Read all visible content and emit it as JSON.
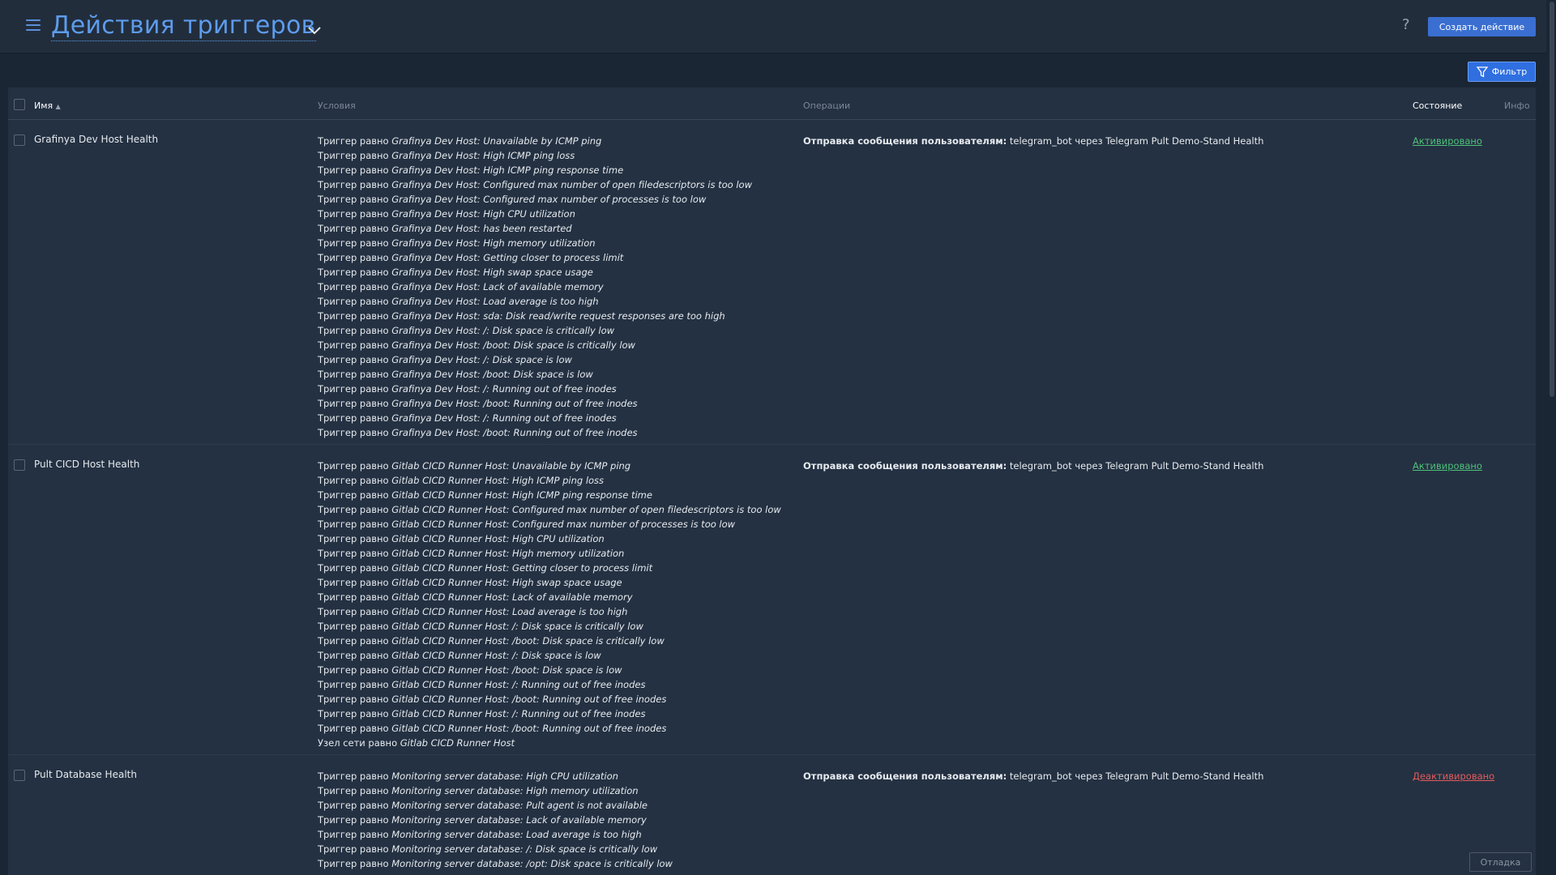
{
  "header": {
    "title": "Действия триггеров",
    "help_label": "?",
    "create_label": "Создать действие"
  },
  "filter": {
    "label": "Фильтр"
  },
  "columns": {
    "name": "Имя",
    "sort_indicator": "▲",
    "conditions": "Условия",
    "operations": "Операции",
    "status": "Состояние",
    "info": "Инфо"
  },
  "rows": [
    {
      "name": "Grafinya Dev Host Health",
      "conditions": [
        {
          "prefix": "Триггер равно",
          "value": "Grafinya Dev Host: Unavailable by ICMP ping"
        },
        {
          "prefix": "Триггер равно",
          "value": "Grafinya Dev Host: High ICMP ping loss"
        },
        {
          "prefix": "Триггер равно",
          "value": "Grafinya Dev Host: High ICMP ping response time"
        },
        {
          "prefix": "Триггер равно",
          "value": "Grafinya Dev Host: Configured max number of open filedescriptors is too low"
        },
        {
          "prefix": "Триггер равно",
          "value": "Grafinya Dev Host: Configured max number of processes is too low"
        },
        {
          "prefix": "Триггер равно",
          "value": "Grafinya Dev Host: High CPU utilization"
        },
        {
          "prefix": "Триггер равно",
          "value": "Grafinya Dev Host: has been restarted"
        },
        {
          "prefix": "Триггер равно",
          "value": "Grafinya Dev Host: High memory utilization"
        },
        {
          "prefix": "Триггер равно",
          "value": "Grafinya Dev Host: Getting closer to process limit"
        },
        {
          "prefix": "Триггер равно",
          "value": "Grafinya Dev Host: High swap space usage"
        },
        {
          "prefix": "Триггер равно",
          "value": "Grafinya Dev Host: Lack of available memory"
        },
        {
          "prefix": "Триггер равно",
          "value": "Grafinya Dev Host: Load average is too high"
        },
        {
          "prefix": "Триггер равно",
          "value": "Grafinya Dev Host: sda: Disk read/write request responses are too high"
        },
        {
          "prefix": "Триггер равно",
          "value": "Grafinya Dev Host: /: Disk space is critically low"
        },
        {
          "prefix": "Триггер равно",
          "value": "Grafinya Dev Host: /boot: Disk space is critically low"
        },
        {
          "prefix": "Триггер равно",
          "value": "Grafinya Dev Host: /: Disk space is low"
        },
        {
          "prefix": "Триггер равно",
          "value": "Grafinya Dev Host: /boot: Disk space is low"
        },
        {
          "prefix": "Триггер равно",
          "value": "Grafinya Dev Host: /: Running out of free inodes"
        },
        {
          "prefix": "Триггер равно",
          "value": "Grafinya Dev Host: /boot: Running out of free inodes"
        },
        {
          "prefix": "Триггер равно",
          "value": "Grafinya Dev Host: /: Running out of free inodes"
        },
        {
          "prefix": "Триггер равно",
          "value": "Grafinya Dev Host: /boot: Running out of free inodes"
        }
      ],
      "operation_label": "Отправка сообщения пользователям:",
      "operation_value": "telegram_bot через Telegram Pult Demo-Stand Health",
      "status": "Активировано",
      "status_state": "on"
    },
    {
      "name": "Pult CICD Host Health",
      "conditions": [
        {
          "prefix": "Триггер равно",
          "value": "Gitlab CICD Runner Host: Unavailable by ICMP ping"
        },
        {
          "prefix": "Триггер равно",
          "value": "Gitlab CICD Runner Host: High ICMP ping loss"
        },
        {
          "prefix": "Триггер равно",
          "value": "Gitlab CICD Runner Host: High ICMP ping response time"
        },
        {
          "prefix": "Триггер равно",
          "value": "Gitlab CICD Runner Host: Configured max number of open filedescriptors is too low"
        },
        {
          "prefix": "Триггер равно",
          "value": "Gitlab CICD Runner Host: Configured max number of processes is too low"
        },
        {
          "prefix": "Триггер равно",
          "value": "Gitlab CICD Runner Host: High CPU utilization"
        },
        {
          "prefix": "Триггер равно",
          "value": "Gitlab CICD Runner Host: High memory utilization"
        },
        {
          "prefix": "Триггер равно",
          "value": "Gitlab CICD Runner Host: Getting closer to process limit"
        },
        {
          "prefix": "Триггер равно",
          "value": "Gitlab CICD Runner Host: High swap space usage"
        },
        {
          "prefix": "Триггер равно",
          "value": "Gitlab CICD Runner Host: Lack of available memory"
        },
        {
          "prefix": "Триггер равно",
          "value": "Gitlab CICD Runner Host: Load average is too high"
        },
        {
          "prefix": "Триггер равно",
          "value": "Gitlab CICD Runner Host: /: Disk space is critically low"
        },
        {
          "prefix": "Триггер равно",
          "value": "Gitlab CICD Runner Host: /boot: Disk space is critically low"
        },
        {
          "prefix": "Триггер равно",
          "value": "Gitlab CICD Runner Host: /: Disk space is low"
        },
        {
          "prefix": "Триггер равно",
          "value": "Gitlab CICD Runner Host: /boot: Disk space is low"
        },
        {
          "prefix": "Триггер равно",
          "value": "Gitlab CICD Runner Host: /: Running out of free inodes"
        },
        {
          "prefix": "Триггер равно",
          "value": "Gitlab CICD Runner Host: /boot: Running out of free inodes"
        },
        {
          "prefix": "Триггер равно",
          "value": "Gitlab CICD Runner Host: /: Running out of free inodes"
        },
        {
          "prefix": "Триггер равно",
          "value": "Gitlab CICD Runner Host: /boot: Running out of free inodes"
        },
        {
          "prefix": "Узел сети равно",
          "value": "Gitlab CICD Runner Host"
        }
      ],
      "operation_label": "Отправка сообщения пользователям:",
      "operation_value": "telegram_bot через Telegram Pult Demo-Stand Health",
      "status": "Активировано",
      "status_state": "on"
    },
    {
      "name": "Pult Database Health",
      "conditions": [
        {
          "prefix": "Триггер равно",
          "value": "Monitoring server database: High CPU utilization"
        },
        {
          "prefix": "Триггер равно",
          "value": "Monitoring server database: High memory utilization"
        },
        {
          "prefix": "Триггер равно",
          "value": "Monitoring server database: Pult agent is not available"
        },
        {
          "prefix": "Триггер равно",
          "value": "Monitoring server database: Lack of available memory"
        },
        {
          "prefix": "Триггер равно",
          "value": "Monitoring server database: Load average is too high"
        },
        {
          "prefix": "Триггер равно",
          "value": "Monitoring server database: /: Disk space is critically low"
        },
        {
          "prefix": "Триггер равно",
          "value": "Monitoring server database: /opt: Disk space is critically low"
        }
      ],
      "operation_label": "Отправка сообщения пользователям:",
      "operation_value": "telegram_bot через Telegram Pult Demo-Stand Health",
      "status": "Деактивировано",
      "status_state": "off"
    }
  ],
  "debug": {
    "label": "Отладка"
  },
  "colors": {
    "accent": "#5d9cec",
    "button": "#3a6fd1",
    "status_on": "#4ec17a",
    "status_off": "#e35b5b"
  }
}
